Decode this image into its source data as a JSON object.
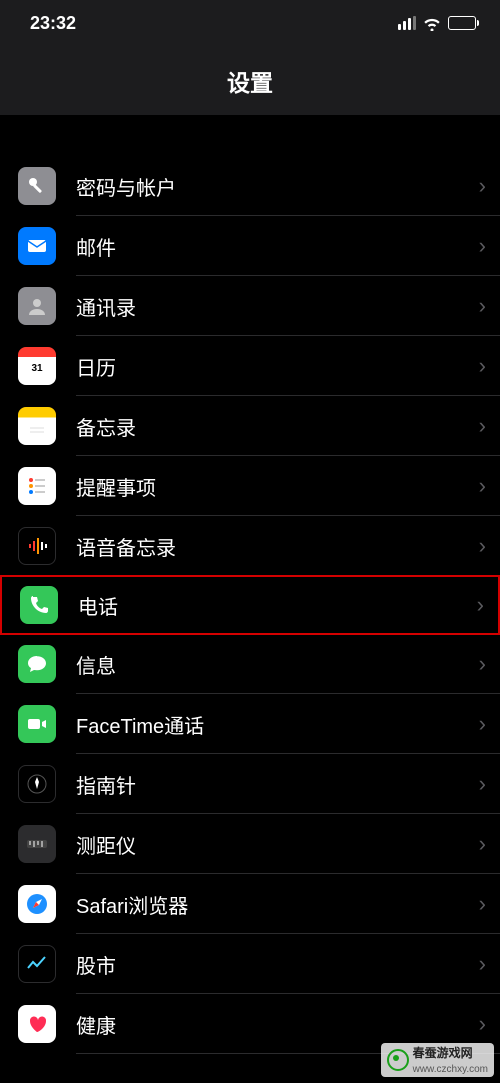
{
  "status": {
    "time": "23:32"
  },
  "header": {
    "title": "设置"
  },
  "rows": {
    "passwords": {
      "label": "密码与帐户"
    },
    "mail": {
      "label": "邮件"
    },
    "contacts": {
      "label": "通讯录"
    },
    "calendar": {
      "label": "日历"
    },
    "notes": {
      "label": "备忘录"
    },
    "reminders": {
      "label": "提醒事项"
    },
    "voicememos": {
      "label": "语音备忘录"
    },
    "phone": {
      "label": "电话"
    },
    "messages": {
      "label": "信息"
    },
    "facetime": {
      "label": "FaceTime通话"
    },
    "compass": {
      "label": "指南针"
    },
    "measure": {
      "label": "测距仪"
    },
    "safari": {
      "label": "Safari浏览器"
    },
    "stocks": {
      "label": "股市"
    },
    "health": {
      "label": "健康"
    }
  },
  "watermark": {
    "name": "春蚕游戏网",
    "url": "www.czchxy.com"
  }
}
